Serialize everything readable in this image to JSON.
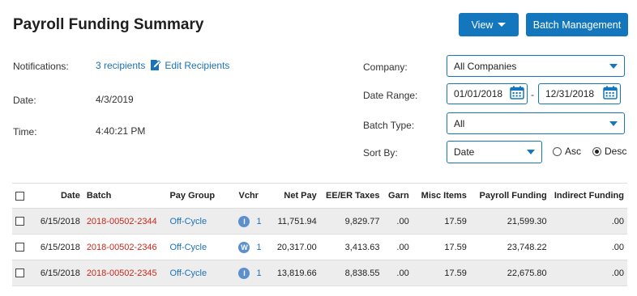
{
  "header": {
    "title": "Payroll Funding Summary",
    "view_button": "View",
    "batch_management_button": "Batch Management"
  },
  "info": {
    "notifications_label": "Notifications:",
    "recipients_link": "3 recipients",
    "edit_recipients_link": "Edit Recipients",
    "date_label": "Date:",
    "date_value": "4/3/2019",
    "time_label": "Time:",
    "time_value": "4:40:21 PM"
  },
  "filters": {
    "company_label": "Company:",
    "company_value": "All Companies",
    "date_range_label": "Date Range:",
    "date_from": "01/01/2018",
    "date_separator": "-",
    "date_to": "12/31/2018",
    "batch_type_label": "Batch Type:",
    "batch_type_value": "All",
    "sort_by_label": "Sort By:",
    "sort_by_value": "Date",
    "asc_label": "Asc",
    "desc_label": "Desc",
    "sort_order_selected": "Desc"
  },
  "table": {
    "columns": [
      "Date",
      "Batch",
      "Pay Group",
      "Vchr",
      "Net Pay",
      "EE/ER Taxes",
      "Garn",
      "Misc Items",
      "Payroll Funding",
      "Indirect Funding"
    ],
    "rows": [
      {
        "date": "6/15/2018",
        "batch": "2018-00502-2344",
        "pay_group": "Off-Cycle",
        "badge": "I",
        "vchr": "1",
        "net_pay": "11,751.94",
        "taxes": "9,829.77",
        "garn": ".00",
        "misc": "17.59",
        "payroll_funding": "21,599.30",
        "indirect": ".00"
      },
      {
        "date": "6/15/2018",
        "batch": "2018-00502-2346",
        "pay_group": "Off-Cycle",
        "badge": "W",
        "vchr": "1",
        "net_pay": "20,317.00",
        "taxes": "3,413.63",
        "garn": ".00",
        "misc": "17.59",
        "payroll_funding": "23,748.22",
        "indirect": ".00"
      },
      {
        "date": "6/15/2018",
        "batch": "2018-00502-2345",
        "pay_group": "Off-Cycle",
        "badge": "I",
        "vchr": "1",
        "net_pay": "13,819.66",
        "taxes": "8,838.55",
        "garn": ".00",
        "misc": "17.59",
        "payroll_funding": "22,675.80",
        "indirect": ".00"
      }
    ]
  },
  "colors": {
    "primary": "#1477bd",
    "link": "#1a72b8",
    "batch_link": "#c8281e",
    "row_stripe": "#ededed"
  }
}
